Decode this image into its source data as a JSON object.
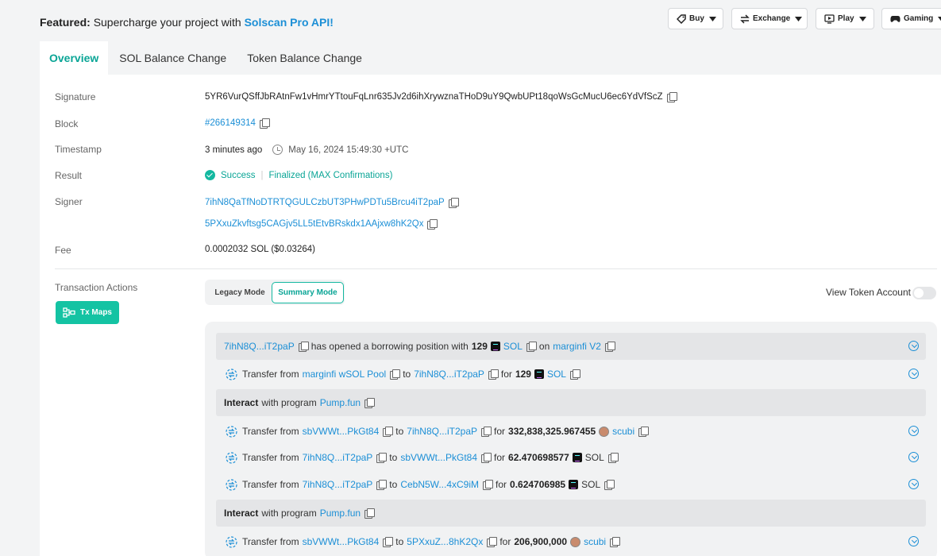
{
  "featured": {
    "label": "Featured:",
    "text": "Supercharge your project with",
    "link": "Solscan Pro API!"
  },
  "topnav": [
    {
      "label": "Buy",
      "icon": "tag-icon"
    },
    {
      "label": "Exchange",
      "icon": "exchange-icon"
    },
    {
      "label": "Play",
      "icon": "play-icon"
    },
    {
      "label": "Gaming",
      "icon": "gamepad-icon"
    }
  ],
  "tabs": [
    "Overview",
    "SOL Balance Change",
    "Token Balance Change"
  ],
  "details": {
    "signature_label": "Signature",
    "signature": "5YR6VurQSffJbRAtnFw1vHmrYTtouFqLnr635Jv2d6ihXrywznaTHoD9uY9QwbUPt18qoWsGcMucU6ec6YdVfScZ",
    "block_label": "Block",
    "block": "#266149314",
    "timestamp_label": "Timestamp",
    "timestamp_relative": "3 minutes ago",
    "timestamp_absolute": "May 16, 2024 15:49:30 +UTC",
    "result_label": "Result",
    "result_status": "Success",
    "result_confirmation": "Finalized (MAX Confirmations)",
    "signer_label": "Signer",
    "signer_1": "7ihN8QaTfNoDTRTQGULCzbUT3PHwPDTu5Brcu4iT2paP",
    "signer_2": "5PXxuZkvftsg5CAGjv5LL5tEtvBRskdx1AAjxw8hK2Qx",
    "fee_label": "Fee",
    "fee": "0.0002032 SOL ($0.03264)"
  },
  "actions_panel": {
    "label": "Transaction Actions",
    "txmap_button": "Tx Maps",
    "legacy_mode": "Legacy Mode",
    "summary_mode": "Summary Mode",
    "view_token_account": "View Token Account"
  },
  "actions": {
    "r1": {
      "addr": "7ihN8Q...iT2paP",
      "text": "has opened a borrowing position with",
      "amount": "129",
      "token": "SOL",
      "on": "on",
      "platform": "marginfi V2"
    },
    "r2": {
      "transfer": "Transfer from",
      "from": "marginfi wSOL Pool",
      "to": "to",
      "to_addr": "7ihN8Q...iT2paP",
      "for": "for",
      "amount": "129",
      "token": "SOL"
    },
    "r3": {
      "interact": "Interact",
      "with": "with program",
      "program": "Pump.fun"
    },
    "r4": {
      "transfer": "Transfer from",
      "from": "sbVWWt...PkGt84",
      "to": "to",
      "to_addr": "7ihN8Q...iT2paP",
      "for": "for",
      "amount": "332,838,325.967455",
      "token": "scubi"
    },
    "r5": {
      "transfer": "Transfer from",
      "from": "7ihN8Q...iT2paP",
      "to": "to",
      "to_addr": "sbVWWt...PkGt84",
      "for": "for",
      "amount": "62.470698577",
      "token": "SOL"
    },
    "r6": {
      "transfer": "Transfer from",
      "from": "7ihN8Q...iT2paP",
      "to": "to",
      "to_addr": "CebN5W...4xC9iM",
      "for": "for",
      "amount": "0.624706985",
      "token": "SOL"
    },
    "r7": {
      "interact": "Interact",
      "with": "with program",
      "program": "Pump.fun"
    },
    "r8": {
      "transfer": "Transfer from",
      "from": "sbVWWt...PkGt84",
      "to": "to",
      "to_addr": "5PXxuZ...8hK2Qx",
      "for": "for",
      "amount": "206,900,000",
      "token": "scubi"
    }
  }
}
